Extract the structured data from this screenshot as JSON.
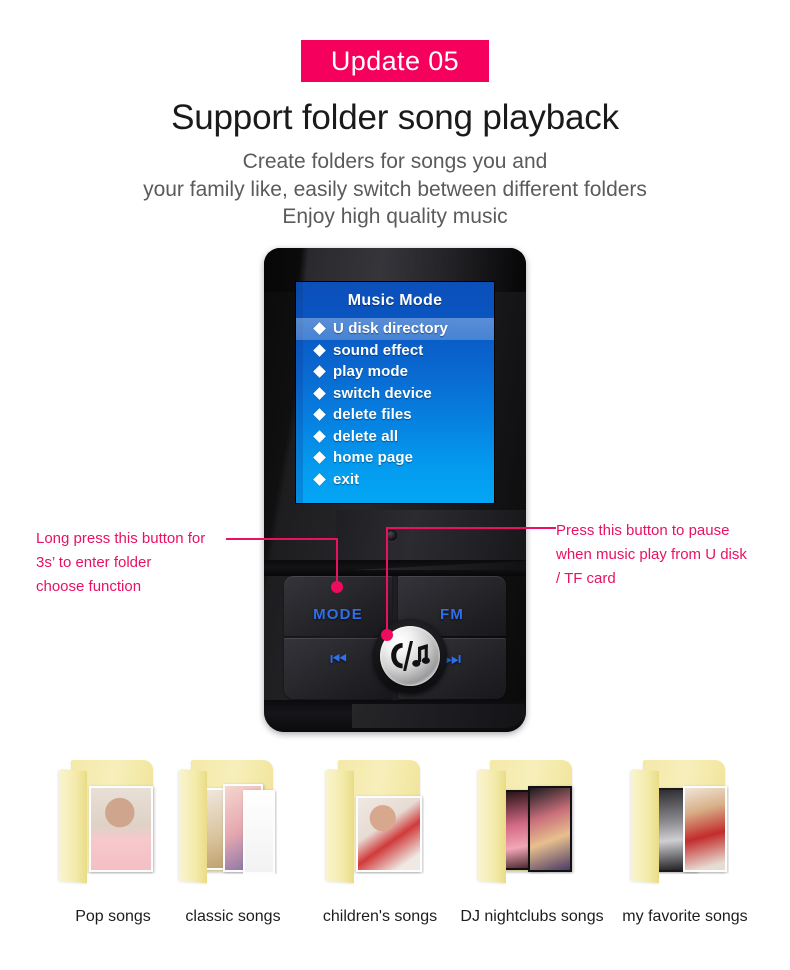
{
  "header": {
    "badge": "Update 05",
    "badge_color": "#f5005c",
    "headline": "Support  folder song playback",
    "sub_line_1": "Create folders for songs you and",
    "sub_line_2": "your family like, easily switch between different folders",
    "sub_line_3": "Enjoy high quality music"
  },
  "device": {
    "screen": {
      "title": "Music Mode",
      "accent_top": "#0c4fba",
      "accent_bottom": "#04a6f4",
      "menu": [
        {
          "label": "U disk directory",
          "selected": true
        },
        {
          "label": "sound effect",
          "selected": false
        },
        {
          "label": "play mode",
          "selected": false
        },
        {
          "label": "switch device",
          "selected": false
        },
        {
          "label": "delete files",
          "selected": false
        },
        {
          "label": "delete all",
          "selected": false
        },
        {
          "label": "home page",
          "selected": false
        },
        {
          "label": "exit",
          "selected": false
        }
      ]
    },
    "keys": {
      "mode": "MODE",
      "fm": "FM",
      "prev_glyph": "⏮",
      "next_glyph": "⏭",
      "center_icon": "phone-slash-music-note-icon"
    }
  },
  "annotations": {
    "left": {
      "line_1": "Long press this button for",
      "line_2": "3s’  to enter folder",
      "line_3": " choose function",
      "color": "#ea1163"
    },
    "right": {
      "line_1": "Press this button to pause",
      "line_2": "when music play from U disk",
      "line_3": "/ TF card",
      "color": "#ea1163"
    }
  },
  "folders": [
    {
      "label": "Pop songs",
      "art": "portrait-woman-pink"
    },
    {
      "label": "classic songs",
      "art": "two-album-covers"
    },
    {
      "label": "children's songs",
      "art": "girl-red-dress"
    },
    {
      "label": "DJ nightclubs songs",
      "art": "dj-party-covers"
    },
    {
      "label": "my favorite songs",
      "art": "magazine-covers"
    }
  ]
}
